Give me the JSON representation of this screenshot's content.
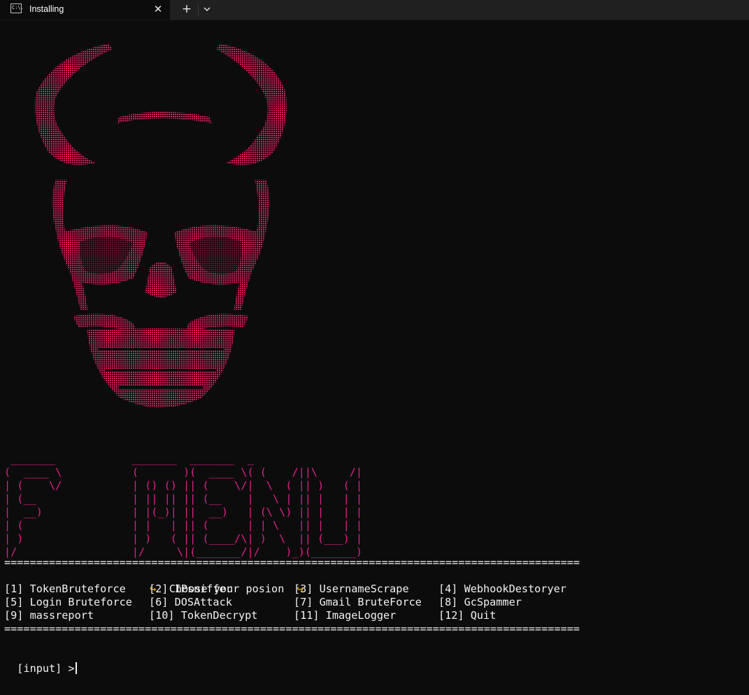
{
  "window": {
    "tab_title": "Installing",
    "tab_icon": "terminal-icon",
    "tab_icon_text": "C:\\."
  },
  "menu_title_art": " _______            _______  _______  _\n(  ____ \\           (       )(  ____ \\( (    /||\\     /|\n| (    \\/           | () () || (    \\/|  \\  ( || )   ( |\n| (__               | || || || (__    |   \\ | || |   | |\n|  __)              | |(_)| ||  __)   | (\\ \\) || |   | |\n| (                 | |   | || (      | | \\   || |   | |\n| )                 | )   ( || (____/\\| )  \\  || (___) |\n|/                  |/     \\|(_______/|/    )_)(_______)",
  "rule": "==========================================================================================",
  "prompt_header": {
    "icon": "spiral-icon",
    "text": "Choose your posion"
  },
  "options": [
    "[1] TokenBruteforce",
    "[2] IPsniffer",
    "[3] UsernameScrape",
    "[4] WebhookDestoryer",
    "[5] Login Bruteforce",
    "[6] DOSAttack",
    "[7] Gmail BruteForce",
    "[8] GcSpammer",
    "[9] massreport",
    "[10] TokenDecrypt",
    "[11] ImageLogger",
    "[12] Quit"
  ],
  "input_prompt": "[input] >",
  "colors": {
    "background": "#0c0c0c",
    "text": "#f2f2f2",
    "menu_art": "#e0218a",
    "skull_top": "#d21a1a",
    "skull_mid": "#e0218a",
    "accent_icon": "#f5b800"
  }
}
